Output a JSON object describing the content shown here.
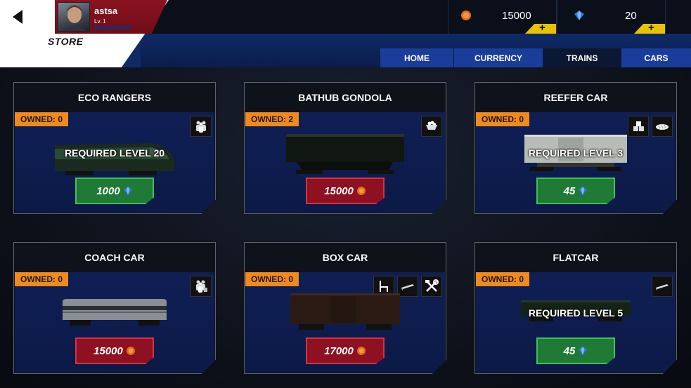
{
  "header": {
    "username": "astsa",
    "level": "Lv. 1",
    "store_label": "STORE"
  },
  "currency": {
    "coins": "15000",
    "gems": "20",
    "plus": "+"
  },
  "tabs": [
    {
      "label": "HOME",
      "active": false
    },
    {
      "label": "CURRENCY",
      "active": false
    },
    {
      "label": "TRAINS",
      "active": true
    },
    {
      "label": "CARS",
      "active": false
    }
  ],
  "cards": [
    {
      "title": "ECO RANGERS",
      "owned": "OWNED: 0",
      "required": "REQUIRED LEVEL 20",
      "price": "1000",
      "currency": "gem",
      "color": "green",
      "icons": [
        "passengers-icon"
      ]
    },
    {
      "title": "BATHUB GONDOLA",
      "owned": "OWNED: 2",
      "required": "",
      "price": "15000",
      "currency": "coin",
      "color": "red",
      "icons": [
        "coal-icon"
      ]
    },
    {
      "title": "REEFER CAR",
      "owned": "OWNED: 0",
      "required": "REQUIRED LEVEL 3",
      "price": "45",
      "currency": "gem",
      "color": "green",
      "icons": [
        "boxes-icon",
        "bread-icon"
      ]
    },
    {
      "title": "COACH CAR",
      "owned": "OWNED: 0",
      "required": "",
      "price": "15000",
      "currency": "coin",
      "color": "red",
      "icons": [
        "passengers-luggage-icon"
      ]
    },
    {
      "title": "BOX CAR",
      "owned": "OWNED: 0",
      "required": "",
      "price": "17000",
      "currency": "coin",
      "color": "red",
      "icons": [
        "chair-icon",
        "plank-icon",
        "tools-icon"
      ]
    },
    {
      "title": "FLATCAR",
      "owned": "OWNED: 0",
      "required": "REQUIRED LEVEL 5",
      "price": "45",
      "currency": "gem",
      "color": "green",
      "icons": [
        "plank-icon"
      ]
    }
  ]
}
